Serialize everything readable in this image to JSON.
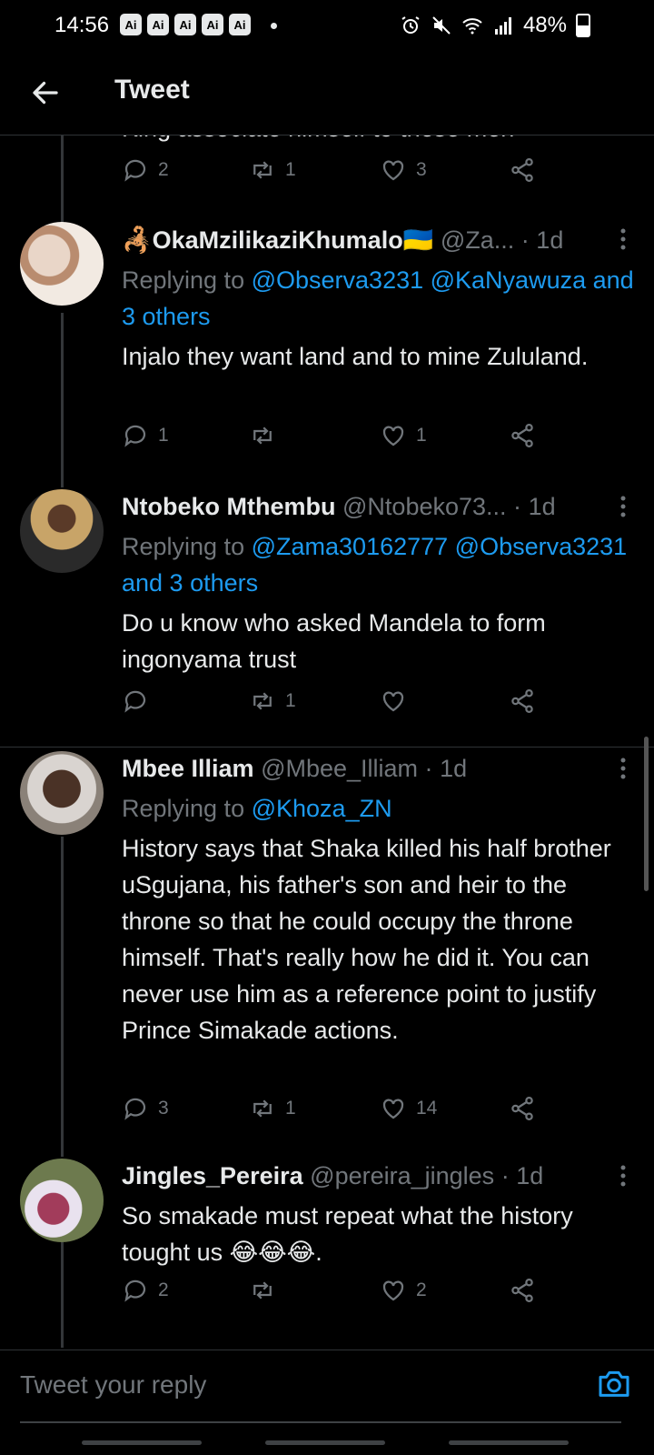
{
  "status_bar": {
    "time": "14:56",
    "ai_badges": [
      "Ai",
      "Ai",
      "Ai",
      "Ai",
      "Ai"
    ],
    "battery": "48%",
    "battery_level": 0.48
  },
  "header": {
    "title": "Tweet"
  },
  "clipped_tweet": {
    "text_fragment": "King associate himself to these men",
    "replies": "2",
    "retweets": "1",
    "likes": "3"
  },
  "tweets": [
    {
      "name": "OkaMzilikaziKhumalo",
      "handle": "@Za...",
      "time": "1d",
      "replying_prefix": "Replying to",
      "mentions": "@Observa3231 @KaNyawuza and 3 others",
      "text": "Injalo they want land and to mine Zululand.",
      "replies": "1",
      "retweets": "",
      "likes": "1"
    },
    {
      "name": "Ntobeko Mthembu",
      "handle": "@Ntobeko73...",
      "time": "1d",
      "replying_prefix": "Replying to",
      "mentions": "@Zama30162777 @Observa3231 and 3 others",
      "text": "Do u know who asked Mandela to form ingonyama trust",
      "replies": "",
      "retweets": "1",
      "likes": ""
    },
    {
      "name": "Mbee Illiam",
      "handle": "@Mbee_Illiam",
      "time": "1d",
      "replying_prefix": "Replying to",
      "mentions": "@Khoza_ZN",
      "text": "History says that Shaka killed his half brother uSgujana, his father's son and heir to the throne so that he could occupy the throne himself. That's really how he did it. You can never use him as a reference point to justify Prince Simakade actions.",
      "replies": "3",
      "retweets": "1",
      "likes": "14"
    },
    {
      "name": "Jingles_Pereira",
      "handle": "@pereira_jingles",
      "time": "1d",
      "text": "So smakade must repeat what the history tought us 😂😂😂.",
      "replies": "2",
      "retweets": "",
      "likes": "2"
    }
  ],
  "reply_box": {
    "placeholder": "Tweet your reply"
  },
  "colors": {
    "accent": "#1d9bf0",
    "muted": "#71767b",
    "background": "#000000"
  }
}
